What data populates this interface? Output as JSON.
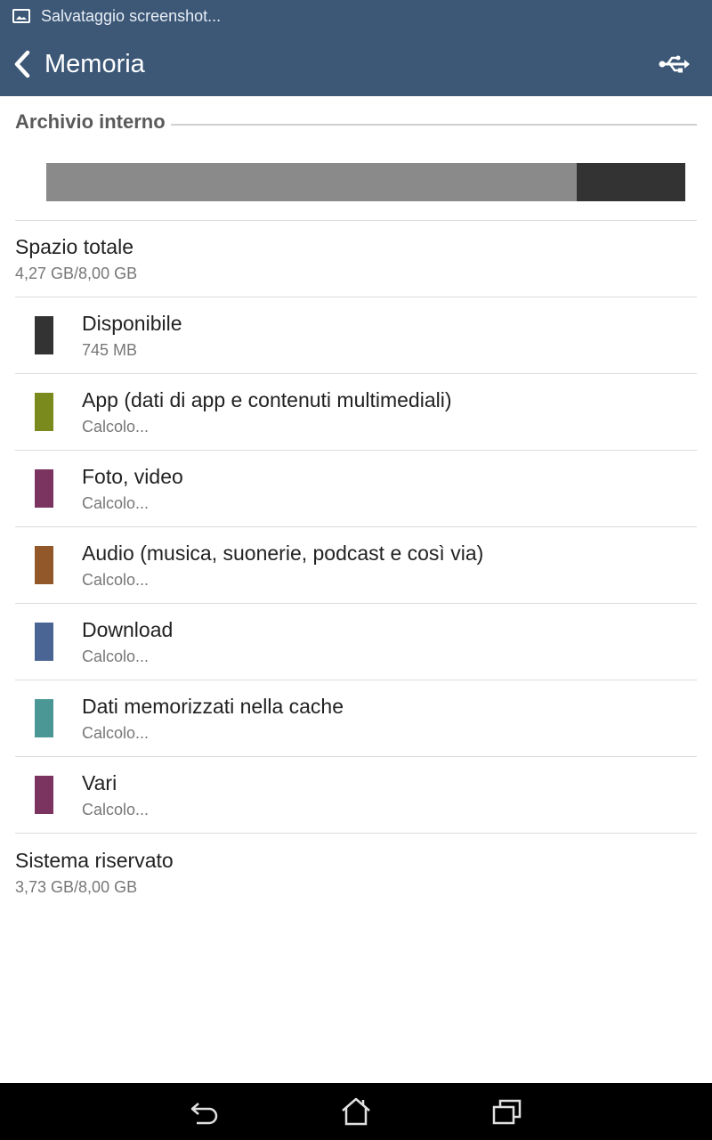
{
  "status_bar": {
    "notification_text": "Salvataggio screenshot..."
  },
  "action_bar": {
    "title": "Memoria"
  },
  "storage": {
    "section_title": "Archivio interno",
    "used_fraction": 0.83,
    "free_fraction": 0.17,
    "colors": {
      "used": "#8a8a8a",
      "free": "#333333"
    }
  },
  "total": {
    "title": "Spazio totale",
    "value": "4,27 GB/8,00 GB"
  },
  "categories": [
    {
      "title": "Disponibile",
      "value": "745 MB",
      "color": "#333333"
    },
    {
      "title": "App (dati di app e contenuti multimediali)",
      "value": "Calcolo...",
      "color": "#7b8a1c"
    },
    {
      "title": "Foto, video",
      "value": "Calcolo...",
      "color": "#7b3460"
    },
    {
      "title": "Audio (musica, suonerie, podcast e così via)",
      "value": "Calcolo...",
      "color": "#93582a"
    },
    {
      "title": "Download",
      "value": "Calcolo...",
      "color": "#4a6494"
    },
    {
      "title": "Dati memorizzati nella cache",
      "value": "Calcolo...",
      "color": "#4a9795"
    },
    {
      "title": "Vari",
      "value": "Calcolo...",
      "color": "#7b3460"
    }
  ],
  "system": {
    "title": "Sistema riservato",
    "value": "3,73 GB/8,00 GB"
  },
  "icons": {
    "notification": "screenshot-image-icon",
    "back": "chevron-left-icon",
    "usb": "usb-icon",
    "nav_back": "back-arrow-icon",
    "nav_home": "home-icon",
    "nav_recents": "recent-apps-icon"
  }
}
